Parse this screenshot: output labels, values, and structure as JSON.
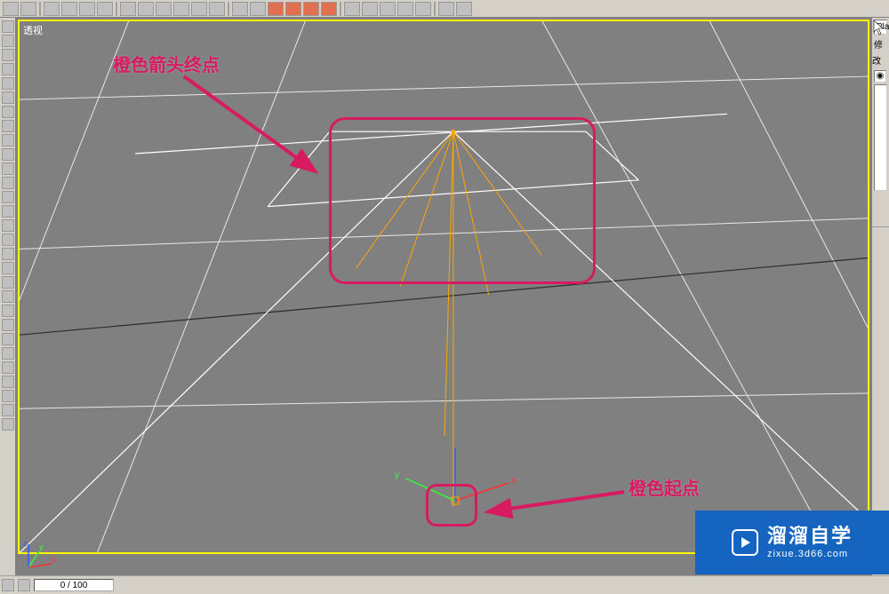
{
  "viewport": {
    "label": "透视"
  },
  "annotations": {
    "top_label": "橙色箭头终点",
    "bottom_label": "橙色起点"
  },
  "right_panel": {
    "object_name": "Pla",
    "modifier_label": "修改"
  },
  "gizmo": {
    "axis_x": "x",
    "axis_y": "y",
    "axis_z": "z"
  },
  "bottom": {
    "timeline": "0 / 100"
  },
  "watermark": {
    "main": "溜溜自学",
    "sub": "zixue.3d66.com"
  }
}
